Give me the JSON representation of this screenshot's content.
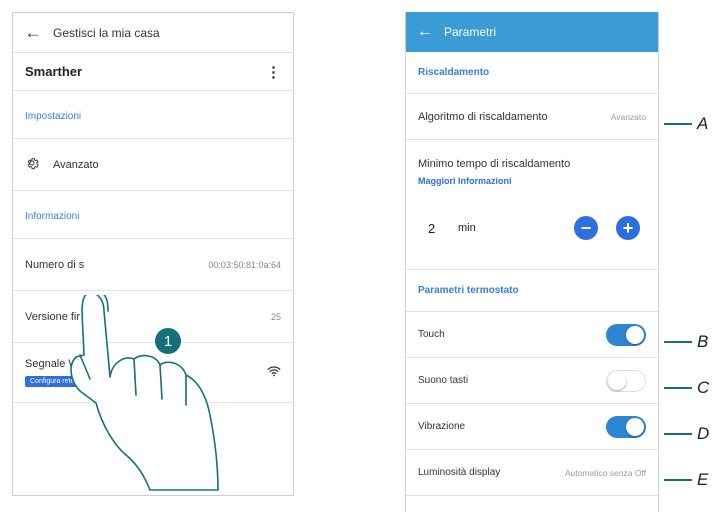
{
  "left": {
    "header_title": "Gestisci la mia casa",
    "device_name": "Smarther",
    "section_settings": "Impostazioni",
    "advanced_label": "Avanzato",
    "section_info": "Informazioni",
    "serial_label": "Numero di s",
    "serial_value": "00:03:50:81:0a:64",
    "firmware_label": "Versione fir",
    "firmware_value": "25",
    "wifi_label": "Segnale Wi-F",
    "config_button": "Configura rete"
  },
  "step_number": "1",
  "right": {
    "header_title": "Parametri",
    "section_heating": "Riscaldamento",
    "algorithm_label": "Algoritmo di riscaldamento",
    "algorithm_value": "Avanzato",
    "min_time_label": "Minimo tempo di riscaldamento",
    "more_info": "Maggiori Informazioni",
    "min_value": "2",
    "min_unit": "min",
    "section_thermostat": "Parametri termostato",
    "touch_label": "Touch",
    "touch_on": true,
    "sound_label": "Suono tasti",
    "sound_on": false,
    "vibration_label": "Vibrazione",
    "vibration_on": true,
    "brightness_label": "Luminosità display",
    "brightness_value": "Automatico senza Off"
  },
  "callouts": [
    "A",
    "B",
    "C",
    "D",
    "E"
  ],
  "colors": {
    "accent_blue": "#3a9bd5",
    "link_blue": "#2c6fe0",
    "callout_teal": "#16707a"
  }
}
